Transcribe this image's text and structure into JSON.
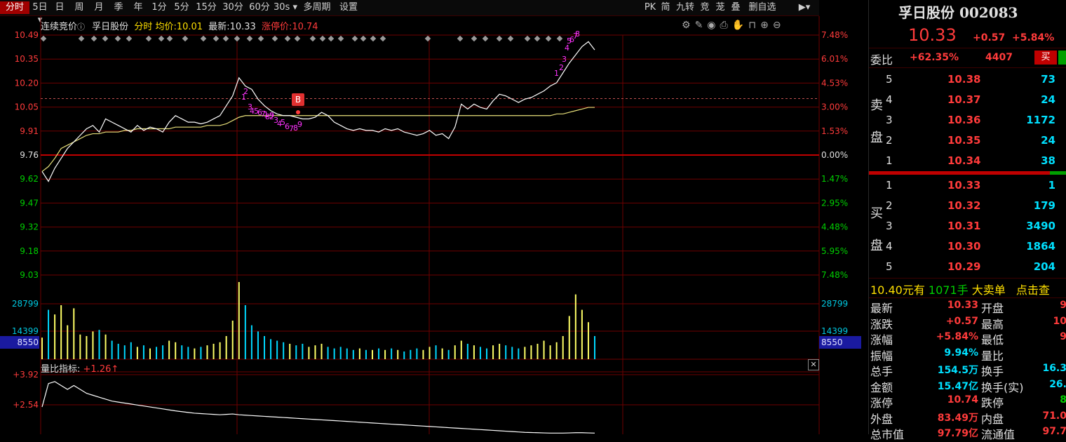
{
  "toolbar": {
    "tabs": [
      "分时",
      "5日",
      "日",
      "周",
      "月",
      "季",
      "年",
      "1分",
      "5分",
      "15分",
      "30分",
      "60分",
      "30s",
      "多周期",
      "设置"
    ],
    "right_tools": [
      "PK",
      "简",
      "九转",
      "竞",
      "茏",
      "叠",
      "删自选"
    ]
  },
  "header": {
    "auction_label": "连续竞价",
    "stock_name": "孚日股份",
    "mode": "分时",
    "avg_label": "均价:",
    "avg_value": "10.01",
    "latest_label": "最新:",
    "latest_value": "10.33",
    "limit_label": "涨停价:",
    "limit_value": "10.74",
    "buy_marker": "B"
  },
  "indicator": {
    "label": "量比指标:",
    "value": "+1.26↑"
  },
  "colors": {
    "up": "#ff3b3b",
    "down": "#00d000",
    "price_line": "#ffffff",
    "avg_line": "#e8e07a",
    "grid": "#6e0000",
    "vol_up": "#ffff66",
    "vol_down": "#00d8ff",
    "signal": "#ff33ff"
  },
  "chart_data": {
    "type": "line",
    "y_price_ticks": [
      "10.49",
      "10.35",
      "10.20",
      "10.05",
      "9.91",
      "9.76",
      "9.62",
      "9.47",
      "9.32",
      "9.18",
      "9.03"
    ],
    "y_pct_ticks": [
      "7.48%",
      "6.01%",
      "4.53%",
      "3.00%",
      "1.53%",
      "0.00%",
      "1.47%",
      "2.95%",
      "4.48%",
      "5.95%",
      "7.48%"
    ],
    "ylim": [
      9.03,
      10.49
    ],
    "prev_close": 9.76,
    "avg_price": 10.01,
    "price": [
      9.66,
      9.6,
      9.68,
      9.74,
      9.8,
      9.84,
      9.88,
      9.92,
      9.94,
      9.9,
      9.98,
      9.96,
      9.94,
      9.92,
      9.9,
      9.94,
      9.91,
      9.93,
      9.92,
      9.9,
      9.96,
      10.0,
      9.98,
      9.96,
      9.96,
      9.95,
      9.96,
      9.98,
      10.0,
      10.06,
      10.12,
      10.23,
      10.18,
      10.16,
      10.1,
      10.06,
      10.03,
      10.01,
      10.0,
      10.0,
      9.99,
      9.98,
      9.98,
      9.99,
      10.02,
      10.0,
      9.96,
      9.94,
      9.92,
      9.91,
      9.92,
      9.91,
      9.91,
      9.9,
      9.92,
      9.91,
      9.92,
      9.9,
      9.89,
      9.88,
      9.89,
      9.91,
      9.88,
      9.89,
      9.86,
      9.93,
      10.07,
      10.04,
      10.07,
      10.05,
      10.04,
      10.09,
      10.13,
      10.12,
      10.1,
      10.08,
      10.1,
      10.11,
      10.13,
      10.15,
      10.18,
      10.2,
      10.26,
      10.32,
      10.37,
      10.42,
      10.45,
      10.4
    ],
    "avg": [
      9.66,
      9.69,
      9.74,
      9.8,
      9.82,
      9.84,
      9.86,
      9.88,
      9.89,
      9.89,
      9.9,
      9.9,
      9.9,
      9.91,
      9.91,
      9.92,
      9.92,
      9.92,
      9.92,
      9.92,
      9.92,
      9.93,
      9.93,
      9.93,
      9.93,
      9.93,
      9.94,
      9.94,
      9.94,
      9.95,
      9.97,
      9.99,
      10.0,
      10.0,
      10.0,
      10.0,
      10.0,
      10.0,
      10.0,
      10.0,
      10.0,
      10.0,
      10.0,
      10.0,
      10.0,
      10.0,
      10.0,
      10.0,
      10.0,
      10.0,
      10.0,
      10.0,
      10.0,
      10.0,
      10.0,
      10.0,
      10.0,
      10.0,
      10.0,
      10.0,
      10.0,
      10.0,
      10.0,
      10.0,
      10.0,
      10.0,
      10.0,
      10.0,
      10.0,
      10.0,
      10.0,
      10.0,
      10.0,
      10.0,
      10.0,
      10.0,
      10.0,
      10.0,
      10.0,
      10.0,
      10.0,
      10.01,
      10.01,
      10.02,
      10.03,
      10.04,
      10.05,
      10.05
    ],
    "vol_ticks": [
      "28799",
      "14399",
      "8550"
    ],
    "volume": [
      14000,
      32000,
      29000,
      35000,
      22000,
      33000,
      16000,
      15000,
      18000,
      19000,
      16000,
      12000,
      10000,
      9000,
      11000,
      8000,
      9000,
      7000,
      8000,
      9000,
      12000,
      11000,
      9000,
      8000,
      7000,
      8000,
      9000,
      10000,
      11000,
      15000,
      25000,
      50000,
      35000,
      22000,
      18000,
      15000,
      13000,
      12000,
      11000,
      10000,
      9000,
      10000,
      8000,
      9000,
      10000,
      8000,
      7000,
      8000,
      7000,
      6000,
      7000,
      6000,
      6000,
      7000,
      6000,
      7000,
      6000,
      5000,
      6000,
      7000,
      6000,
      8000,
      9000,
      7000,
      6000,
      9000,
      12000,
      10000,
      9000,
      8000,
      7000,
      9000,
      10000,
      9000,
      8000,
      7000,
      8000,
      9000,
      10000,
      12000,
      9000,
      11000,
      15000,
      28000,
      42000,
      32000,
      24000,
      15000
    ],
    "vol_max": 50000,
    "ratio_ticks": [
      "+3.92",
      "+2.54"
    ],
    "ratio_ylim": [
      1.2,
      4.4
    ],
    "ratio": [
      2.6,
      3.8,
      3.9,
      3.7,
      3.5,
      3.7,
      3.5,
      3.3,
      3.2,
      3.1,
      3.0,
      2.9,
      2.85,
      2.8,
      2.75,
      2.7,
      2.65,
      2.6,
      2.55,
      2.5,
      2.45,
      2.4,
      2.36,
      2.32,
      2.28,
      2.26,
      2.24,
      2.22,
      2.2,
      2.22,
      2.24,
      2.2,
      2.18,
      2.16,
      2.14,
      2.12,
      2.1,
      2.08,
      2.06,
      2.04,
      2.02,
      2.0,
      1.98,
      1.96,
      1.94,
      1.92,
      1.9,
      1.88,
      1.86,
      1.84,
      1.82,
      1.8,
      1.78,
      1.76,
      1.74,
      1.72,
      1.7,
      1.68,
      1.66,
      1.64,
      1.62,
      1.6,
      1.58,
      1.56,
      1.54,
      1.52,
      1.5,
      1.48,
      1.46,
      1.44,
      1.42,
      1.4,
      1.38,
      1.36,
      1.34,
      1.32,
      1.3,
      1.29,
      1.28,
      1.27,
      1.26,
      1.26,
      1.26,
      1.27,
      1.28,
      1.28,
      1.27,
      1.26
    ],
    "signals_left": [
      "1",
      "2",
      "3",
      "4",
      "5",
      "6",
      "7",
      "8",
      "9",
      "1",
      "2",
      "3",
      "4",
      "5",
      "6",
      "7",
      "8",
      "9"
    ],
    "signals_right": [
      "1",
      "2",
      "3",
      "4",
      "5",
      "6",
      "7",
      "8"
    ]
  },
  "quote_panel": {
    "title": "孚日股份 002083",
    "price": "10.33",
    "change": "+0.57",
    "change_pct": "+5.84%",
    "weibi_label": "委比",
    "weibi_value": "+62.35%",
    "weibi_diff": "4407",
    "buy_btn": "买",
    "sell_side_label": [
      "卖",
      "盘"
    ],
    "buy_side_label": [
      "买",
      "盘"
    ],
    "asks": [
      {
        "level": "5",
        "price": "10.38",
        "vol": "73"
      },
      {
        "level": "4",
        "price": "10.37",
        "vol": "24"
      },
      {
        "level": "3",
        "price": "10.36",
        "vol": "1172"
      },
      {
        "level": "2",
        "price": "10.35",
        "vol": "24"
      },
      {
        "level": "1",
        "price": "10.34",
        "vol": "38"
      }
    ],
    "bids": [
      {
        "level": "1",
        "price": "10.33",
        "vol": "1"
      },
      {
        "level": "2",
        "price": "10.32",
        "vol": "179"
      },
      {
        "level": "3",
        "price": "10.31",
        "vol": "3490"
      },
      {
        "level": "4",
        "price": "10.30",
        "vol": "1864"
      },
      {
        "level": "5",
        "price": "10.29",
        "vol": "204"
      }
    ],
    "bigorder": {
      "price": "10.40",
      "t1": "元有",
      "qty": "1071手",
      "t2": "大卖单",
      "link": "点击查"
    },
    "stats": [
      {
        "l1": "最新",
        "v1": "10.33",
        "l2": "开盘",
        "v2": "9"
      },
      {
        "l1": "涨跌",
        "v1": "+0.57",
        "l2": "最高",
        "v2": "10"
      },
      {
        "l1": "涨幅",
        "v1": "+5.84%",
        "l2": "最低",
        "v2": "9"
      },
      {
        "l1": "振幅",
        "v1": "9.94%",
        "l2": "量比",
        "v2": ""
      },
      {
        "l1": "总手",
        "v1": "154.5万",
        "l2": "换手",
        "v2": "16.3"
      },
      {
        "l1": "金额",
        "v1": "15.47亿",
        "l2": "换手(实)",
        "v2": "26."
      },
      {
        "l1": "涨停",
        "v1": "10.74",
        "l2": "跌停",
        "v2": "8"
      },
      {
        "l1": "外盘",
        "v1": "83.49万",
        "l2": "内盘",
        "v2": "71.0"
      },
      {
        "l1": "总市值",
        "v1": "97.79亿",
        "l2": "流通值",
        "v2": "97.7"
      }
    ]
  }
}
